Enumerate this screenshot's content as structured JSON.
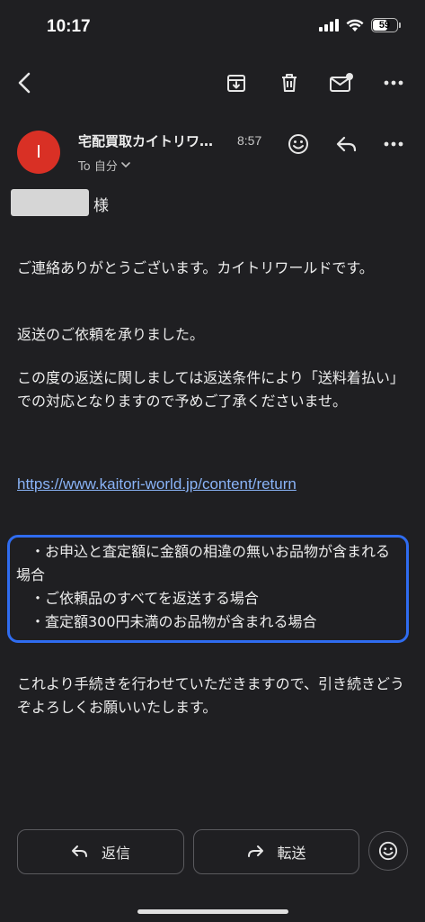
{
  "status_bar": {
    "time": "10:17",
    "battery": "59"
  },
  "email": {
    "sender_initial": "I",
    "sender_name": "宅配買取カイトリワ…",
    "time": "8:57",
    "recipient": "To 自分",
    "honorific": "様",
    "paragraphs": [
      "ご連絡ありがとうございます。カイトリワールドです。",
      "返送のご依頼を承りました。",
      "この度の返送に関しましては返送条件により「送料着払い」での対応となりますので予めご了承くださいませ。"
    ],
    "link": "https://www.kaitori-world.jp/content/return",
    "conditions": [
      "　・お申込と査定額に金額の相違の無いお品物が含まれる場合",
      "　・ご依頼品のすべてを返送する場合",
      "　・査定額300円未満のお品物が含まれる場合"
    ],
    "closing": "これより手続きを行わせていただきますので、引き続きどうぞよろしくお願いいたします。"
  },
  "actions": {
    "reply_label": "返信",
    "forward_label": "転送"
  },
  "icons": {
    "back": "back-chevron-icon",
    "archive": "archive-icon",
    "trash": "trash-icon",
    "unread": "mark-unread-icon",
    "more": "more-dots-icon",
    "emoji": "emoji-icon",
    "reply": "reply-icon",
    "forward": "forward-icon"
  },
  "colors": {
    "avatar": "#d93025",
    "link": "#8ab4f8",
    "highlight_border": "#2f6cf0",
    "background": "#1f1f22"
  }
}
